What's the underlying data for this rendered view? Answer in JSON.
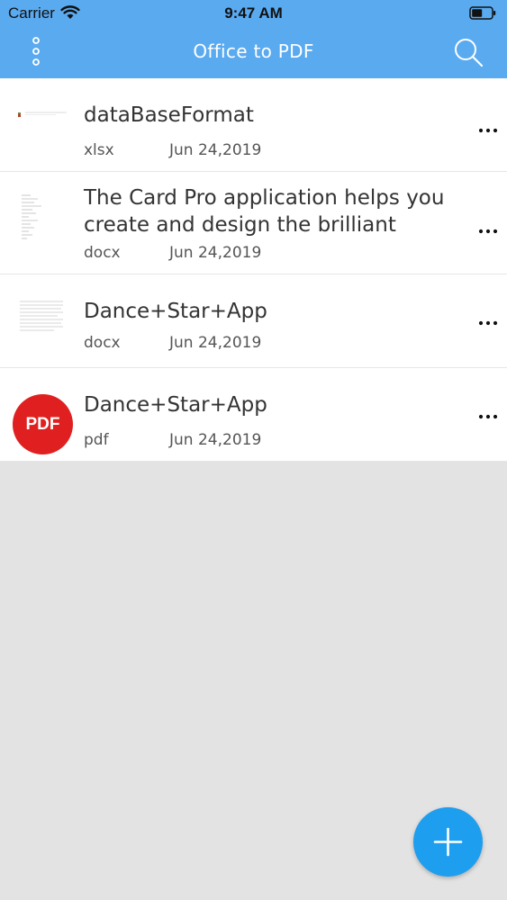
{
  "status_bar": {
    "carrier": "Carrier",
    "time": "9:47 AM"
  },
  "nav": {
    "title": "Office to PDF",
    "menu_icon": "more-vertical-icon",
    "search_icon": "search-icon"
  },
  "files": [
    {
      "title": "dataBaseFormat",
      "type": "xlsx",
      "date": "Jun 24,2019",
      "thumbnail": "spreadsheet-thumbnail"
    },
    {
      "title": "The Card Pro application helps you create and design the brilliant",
      "type": "docx",
      "date": "Jun 24,2019",
      "thumbnail": "document-thumbnail"
    },
    {
      "title": "Dance+Star+App",
      "type": "docx",
      "date": "Jun 24,2019",
      "thumbnail": "document-thumbnail"
    },
    {
      "title": "Dance+Star+App",
      "type": "pdf",
      "date": "Jun 24,2019",
      "badge": "PDF"
    }
  ],
  "fab_icon": "plus-icon",
  "colors": {
    "header": "#5aaaf0",
    "fab": "#1e9eee",
    "pdf_badge": "#e02020",
    "background": "#e3e3e3"
  }
}
